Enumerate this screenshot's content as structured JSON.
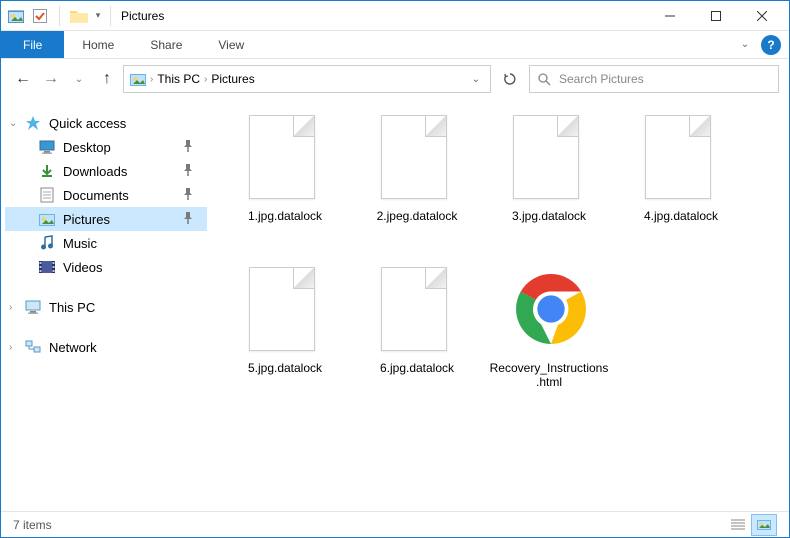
{
  "window": {
    "title": "Pictures"
  },
  "ribbon": {
    "file": "File",
    "tabs": [
      "Home",
      "Share",
      "View"
    ]
  },
  "breadcrumb": {
    "items": [
      "This PC",
      "Pictures"
    ]
  },
  "search": {
    "placeholder": "Search Pictures"
  },
  "sidebar": {
    "quickAccess": "Quick access",
    "items": [
      {
        "label": "Desktop",
        "pinned": true
      },
      {
        "label": "Downloads",
        "pinned": true
      },
      {
        "label": "Documents",
        "pinned": true
      },
      {
        "label": "Pictures",
        "pinned": true,
        "selected": true
      },
      {
        "label": "Music",
        "pinned": false
      },
      {
        "label": "Videos",
        "pinned": false
      }
    ],
    "thisPC": "This PC",
    "network": "Network"
  },
  "files": [
    {
      "name": "1.jpg.datalock",
      "type": "blank"
    },
    {
      "name": "2.jpeg.datalock",
      "type": "blank"
    },
    {
      "name": "3.jpg.datalock",
      "type": "blank"
    },
    {
      "name": "4.jpg.datalock",
      "type": "blank"
    },
    {
      "name": "5.jpg.datalock",
      "type": "blank"
    },
    {
      "name": "6.jpg.datalock",
      "type": "blank"
    },
    {
      "name": "Recovery_Instructions.html",
      "type": "chrome"
    }
  ],
  "status": {
    "count": "7 items"
  }
}
